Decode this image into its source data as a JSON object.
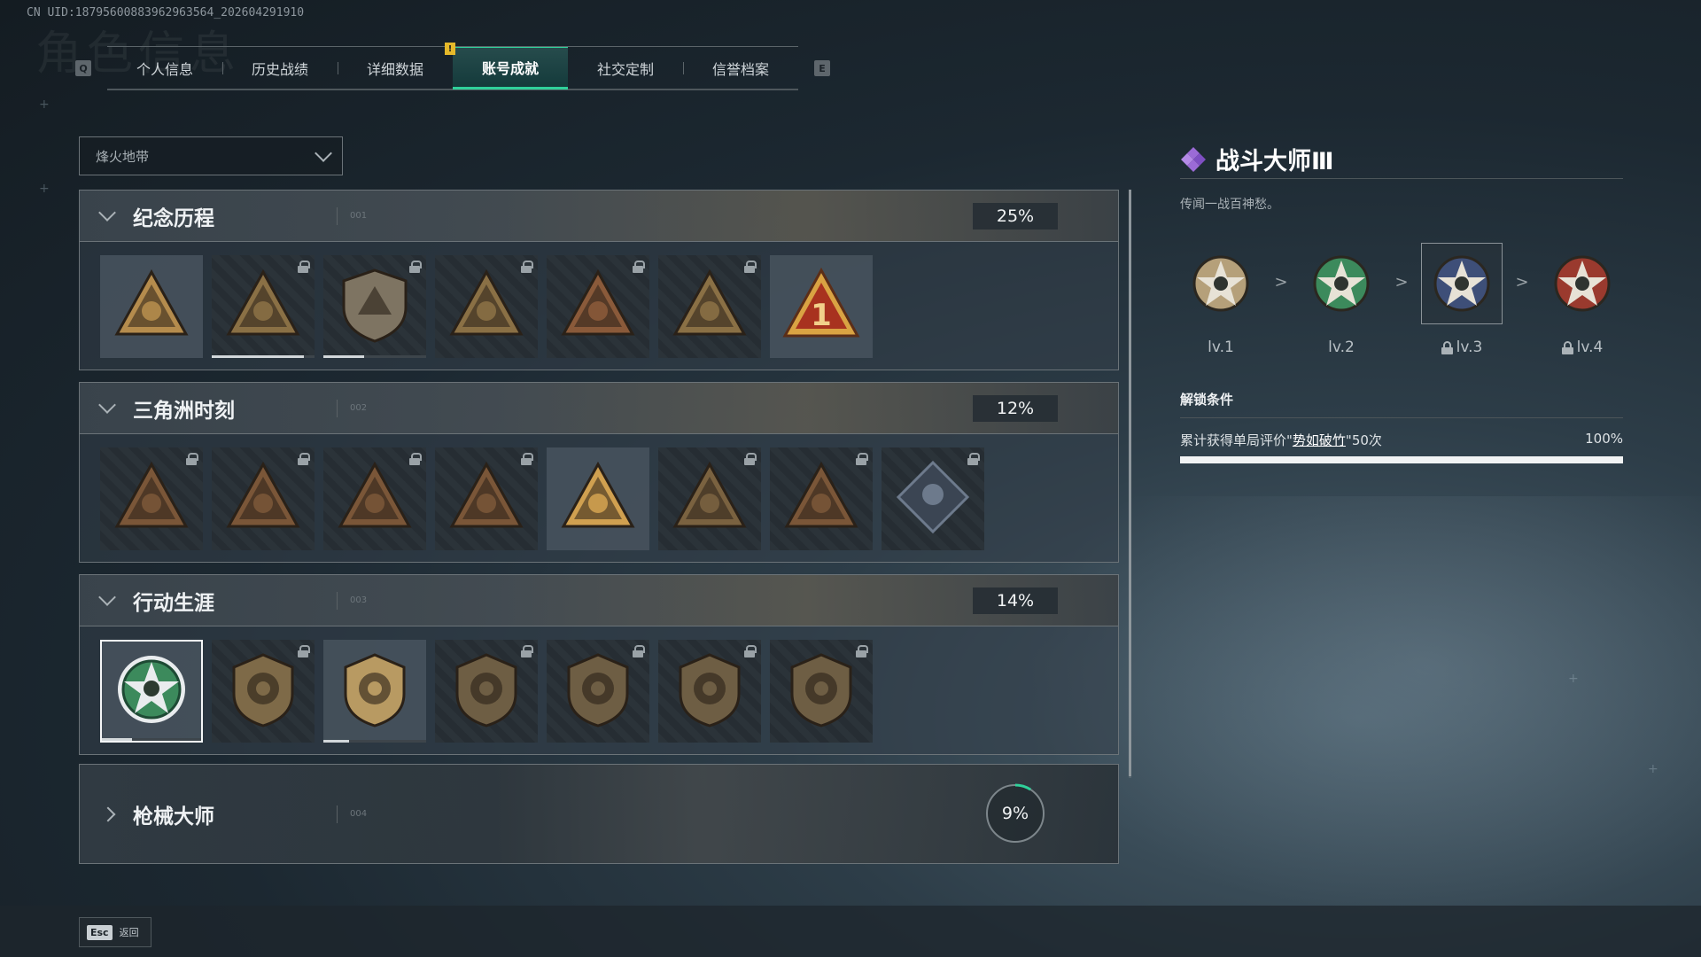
{
  "uid_text": "CN UID:18795600883962963564_202604291910",
  "tabs": {
    "left_key": "Q",
    "right_key": "E",
    "items": [
      "个人信息",
      "历史战绩",
      "详细数据",
      "账号成就",
      "社交定制",
      "信誉档案"
    ],
    "active_index": 3,
    "alert_mark": "!"
  },
  "mode_select": {
    "value": "烽火地带"
  },
  "categories": [
    {
      "title": "纪念历程",
      "index": "001",
      "percent": "25%",
      "expanded": true,
      "badges": [
        {
          "icon": "triangle-shield-badge",
          "locked": false,
          "color": "#b58c4d"
        },
        {
          "icon": "helicopter-badge",
          "locked": true,
          "color": "#8a7045",
          "progress": 0.9
        },
        {
          "icon": "diamond-emblem-badge",
          "locked": true,
          "color": "#7e7462",
          "progress": 0.4
        },
        {
          "icon": "tripod-badge",
          "locked": true,
          "color": "#8a7045"
        },
        {
          "icon": "hooded-figure-badge",
          "locked": true,
          "color": "#8a5a3a"
        },
        {
          "icon": "crossed-rifles-badge",
          "locked": true,
          "color": "#8a7045"
        },
        {
          "icon": "number-one-badge",
          "locked": false,
          "color": "#d9a343"
        }
      ]
    },
    {
      "title": "三角洲时刻",
      "index": "002",
      "percent": "12%",
      "expanded": true,
      "badges": [
        {
          "icon": "bottle-triangle-badge",
          "locked": true,
          "color": "#7a5638"
        },
        {
          "icon": "shield-triangle-badge",
          "locked": true,
          "color": "#7a5638"
        },
        {
          "icon": "soldier-triangle-badge",
          "locked": true,
          "color": "#7a5638"
        },
        {
          "icon": "dice-triangle-badge",
          "locked": true,
          "color": "#7a5638"
        },
        {
          "icon": "squad-triangle-badge",
          "locked": false,
          "color": "#d0a050"
        },
        {
          "icon": "beast-triangle-badge",
          "locked": true,
          "color": "#7a6240"
        },
        {
          "icon": "serpent-triangle-badge",
          "locked": true,
          "color": "#7a5638"
        },
        {
          "icon": "rose-diamond-badge",
          "locked": true,
          "color": "#6d7a8c"
        }
      ]
    },
    {
      "title": "行动生涯",
      "index": "003",
      "percent": "14%",
      "expanded": true,
      "badges": [
        {
          "icon": "combat-master-badge",
          "locked": false,
          "selected": true,
          "color": "#3c8a5c",
          "progress": 0.3
        },
        {
          "icon": "plate-crest-badge",
          "locked": true,
          "color": "#7e6a48"
        },
        {
          "icon": "scope-crest-badge",
          "locked": false,
          "color": "#b89a62",
          "progress": 0.25
        },
        {
          "icon": "hex-crest-badge",
          "locked": true,
          "color": "#6e5e44"
        },
        {
          "icon": "ring-crest-badge",
          "locked": true,
          "color": "#6e5e44"
        },
        {
          "icon": "skull-crest-badge",
          "locked": true,
          "color": "#6e5e44"
        },
        {
          "icon": "eye-crest-badge",
          "locked": true,
          "color": "#6e5e44"
        }
      ]
    }
  ],
  "weapon_category": {
    "title": "枪械大师",
    "index": "004",
    "percent": "9%",
    "progress": 0.09
  },
  "detail": {
    "title": "战斗大师Ⅲ",
    "description": "传闻一战百神愁。",
    "levels": [
      {
        "label": "lv.1",
        "locked": false,
        "color": "#b5a07a"
      },
      {
        "label": "lv.2",
        "locked": false,
        "color": "#3c8a5c"
      },
      {
        "label": "lv.3",
        "locked": true,
        "current": true,
        "color": "#3e4f78"
      },
      {
        "label": "lv.4",
        "locked": true,
        "color": "#9a3a2e"
      }
    ],
    "arrow": ">",
    "unlock_title": "解锁条件",
    "condition_prefix": "累计获得单局评价\"",
    "condition_highlight": "势如破竹",
    "condition_suffix": "\"50次",
    "condition_percent": "100%",
    "condition_progress": 1.0
  },
  "footer": {
    "esc_key": "Esc",
    "back_label": "返回"
  },
  "colors": {
    "accent": "#2fd19a",
    "title_icon": "#9b6bd6"
  }
}
